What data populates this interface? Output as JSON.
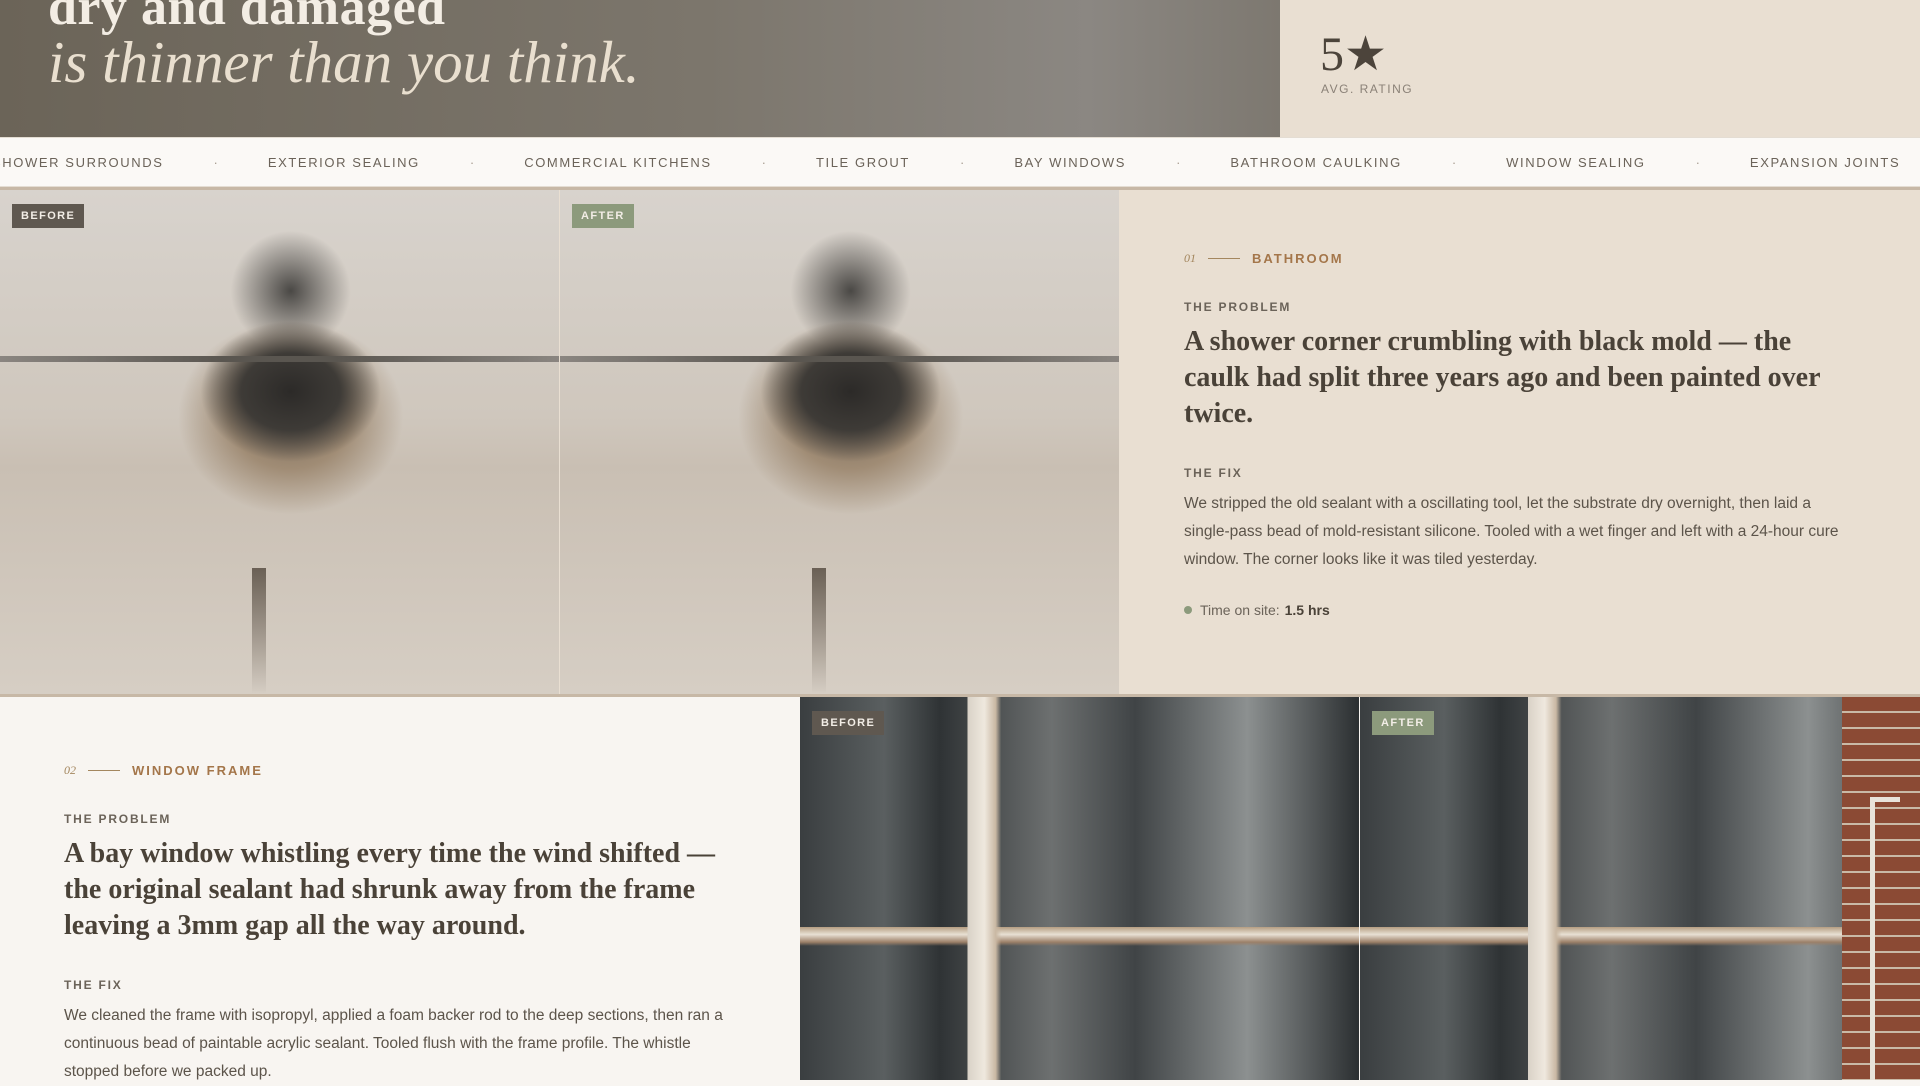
{
  "hero": {
    "title_line1": "dry and damaged",
    "title_line2": "is thinner than you think.",
    "rating_value": "5★",
    "rating_label": "AVG. RATING"
  },
  "ticker": {
    "items": [
      "SHOWER SURROUNDS",
      "EXTERIOR SEALING",
      "COMMERCIAL KITCHENS",
      "TILE GROUT",
      "BAY WINDOWS",
      "BATHROOM CAULKING",
      "WINDOW SEALING",
      "EXPANSION JOINTS"
    ],
    "separator": "·"
  },
  "cases": [
    {
      "number": "01",
      "category": "BATHROOM",
      "before_badge": "BEFORE",
      "after_badge": "AFTER",
      "problem_label": "THE PROBLEM",
      "problem": "A shower corner crumbling with black mold — the caulk had split three years ago and been painted over twice.",
      "fix_label": "THE FIX",
      "fix": "We stripped the old sealant with a oscillating tool, let the substrate dry overnight, then laid a single-pass bead of mold-resistant silicone. Tooled with a wet finger and left with a 24-hour cure window. The corner looks like it was tiled yesterday.",
      "meta_label": "Time on site:",
      "meta_value": "1.5 hrs"
    },
    {
      "number": "02",
      "category": "WINDOW FRAME",
      "before_badge": "BEFORE",
      "after_badge": "AFTER",
      "problem_label": "THE PROBLEM",
      "problem": "A bay window whistling every time the wind shifted — the original sealant had shrunk away from the frame leaving a 3mm gap all the way around.",
      "fix_label": "THE FIX",
      "fix": "We cleaned the frame with isopropyl, applied a foam backer rod to the deep sections, then ran a continuous bead of paintable acrylic sealant. Tooled flush with the frame profile. The whistle stopped before we packed up."
    }
  ]
}
